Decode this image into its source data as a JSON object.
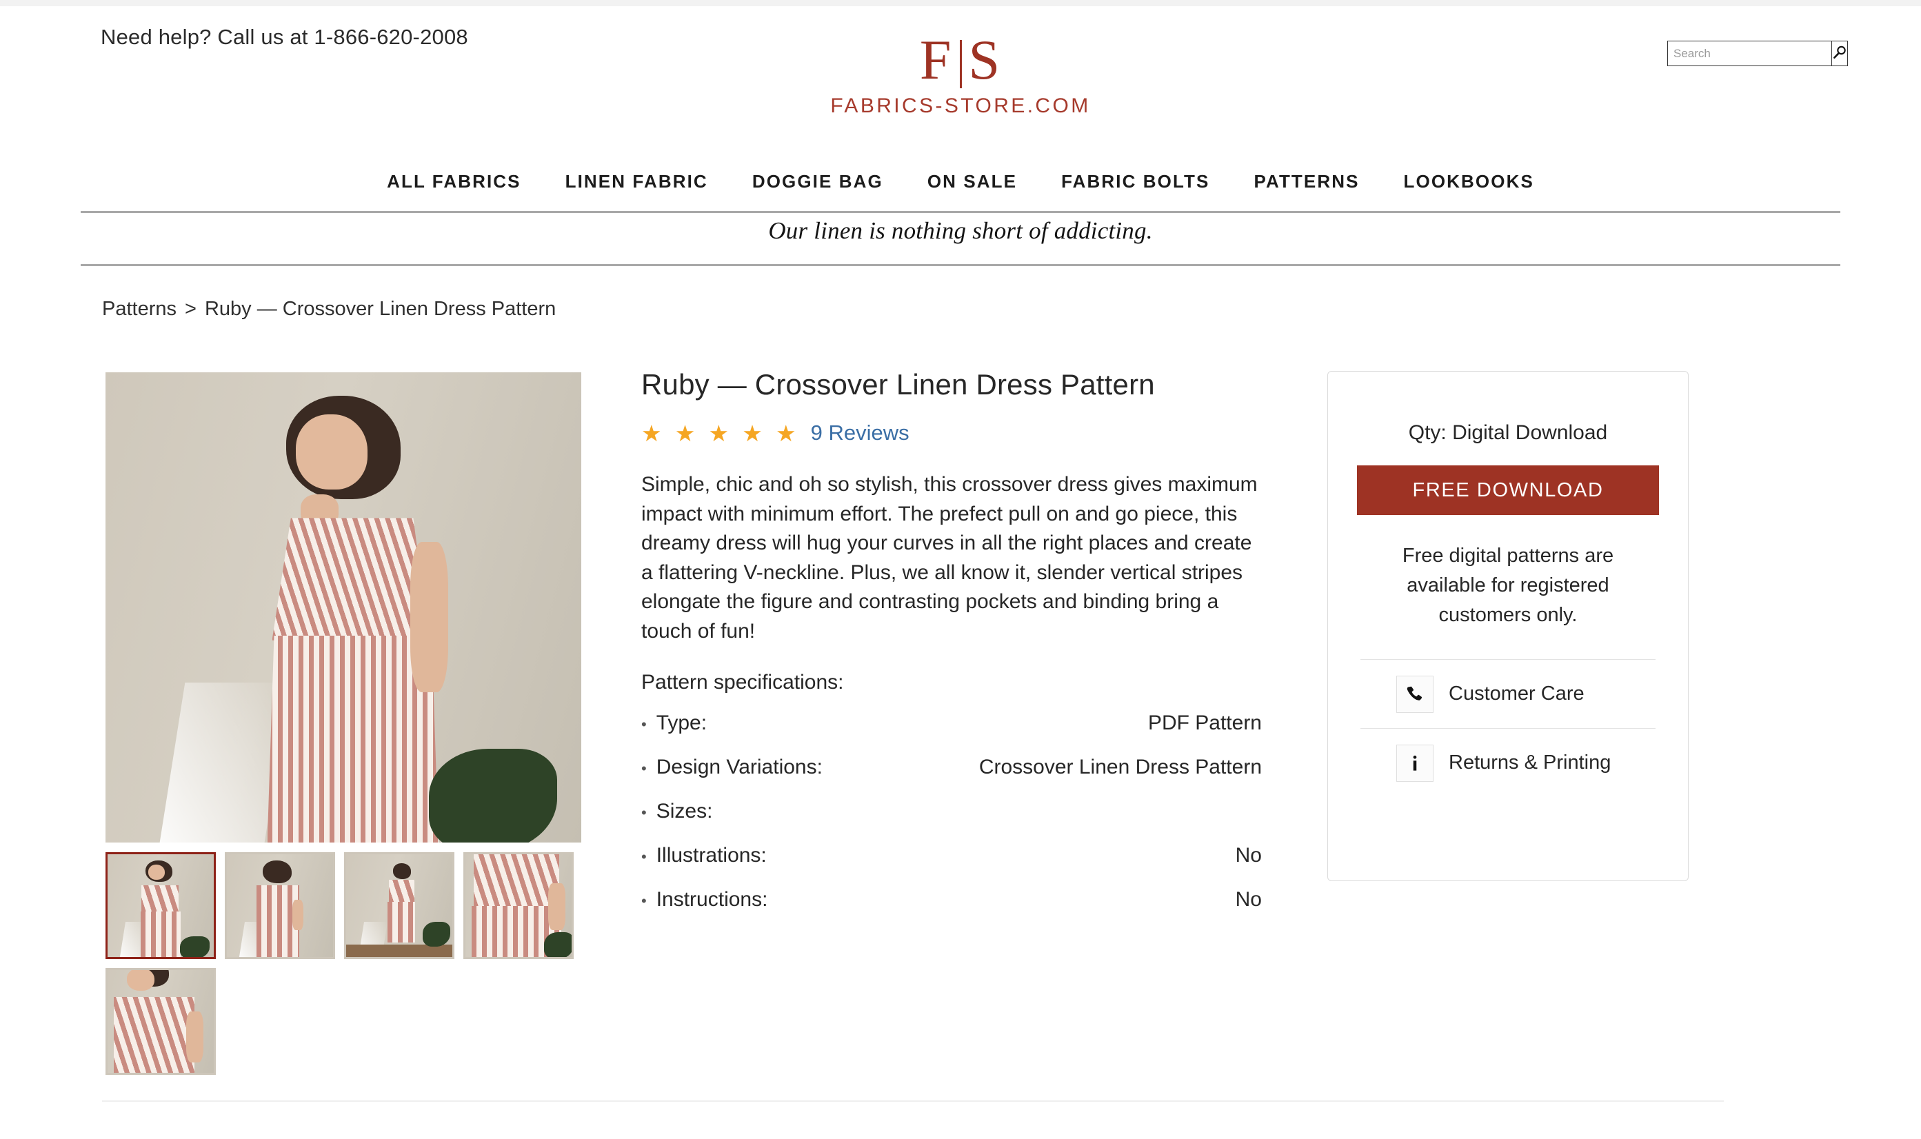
{
  "header": {
    "help_text": "Need help? Call us at 1-866-620-2008",
    "logo_left": "F",
    "logo_right": "S",
    "logo_wordmark": "FABRICS-STORE.COM",
    "brand_color": "#9e3324"
  },
  "search": {
    "placeholder": "Search",
    "value": "",
    "button_icon": "search-icon"
  },
  "nav": {
    "items": [
      {
        "label": "ALL FABRICS"
      },
      {
        "label": "LINEN FABRIC"
      },
      {
        "label": "DOGGIE BAG"
      },
      {
        "label": "ON SALE"
      },
      {
        "label": "FABRIC BOLTS"
      },
      {
        "label": "PATTERNS"
      },
      {
        "label": "LOOKBOOKS"
      }
    ]
  },
  "tagline": "Our linen is nothing short of addicting.",
  "breadcrumb": {
    "parent": "Patterns",
    "separator": ">",
    "current": "Ruby — Crossover Linen Dress Pattern"
  },
  "gallery": {
    "main_alt": "Woman wearing striped crossover linen dress",
    "thumbnails": [
      {
        "alt": "Front view, hands in pockets",
        "selected": true
      },
      {
        "alt": "Back view close",
        "selected": false
      },
      {
        "alt": "Full length side view",
        "selected": false
      },
      {
        "alt": "Back crossover detail",
        "selected": false
      },
      {
        "alt": "Neckline detail",
        "selected": false
      }
    ]
  },
  "product": {
    "title": "Ruby — Crossover Linen Dress Pattern",
    "stars": "★ ★ ★ ★ ★",
    "star_count": 5,
    "star_color": "#f5a623",
    "reviews_label": "9 Reviews",
    "reviews_link_color": "#3a6ea5",
    "description": "Simple, chic and oh so stylish, this crossover dress gives maximum impact with minimum effort. The prefect pull on and go piece, this dreamy dress will hug your curves in all the right places and create a flattering V-neckline. Plus, we all know it, slender vertical stripes elongate the figure and contrasting pockets and binding bring a touch of fun!",
    "spec_heading": "Pattern specifications:",
    "specs": [
      {
        "label": "Type:",
        "value": "PDF Pattern"
      },
      {
        "label": "Design Variations:",
        "value": "Crossover Linen Dress Pattern"
      },
      {
        "label": "Sizes:",
        "value": ""
      },
      {
        "label": "Illustrations:",
        "value": "No"
      },
      {
        "label": "Instructions:",
        "value": "No"
      }
    ]
  },
  "buy_panel": {
    "qty_label": "Qty: Digital Download",
    "download_button": "FREE DOWNLOAD",
    "button_color": "#9e3324",
    "note": "Free digital patterns are available for registered customers only.",
    "links": [
      {
        "label": "Customer Care",
        "icon": "phone-icon"
      },
      {
        "label": "Returns & Printing",
        "icon": "info-icon"
      }
    ]
  }
}
